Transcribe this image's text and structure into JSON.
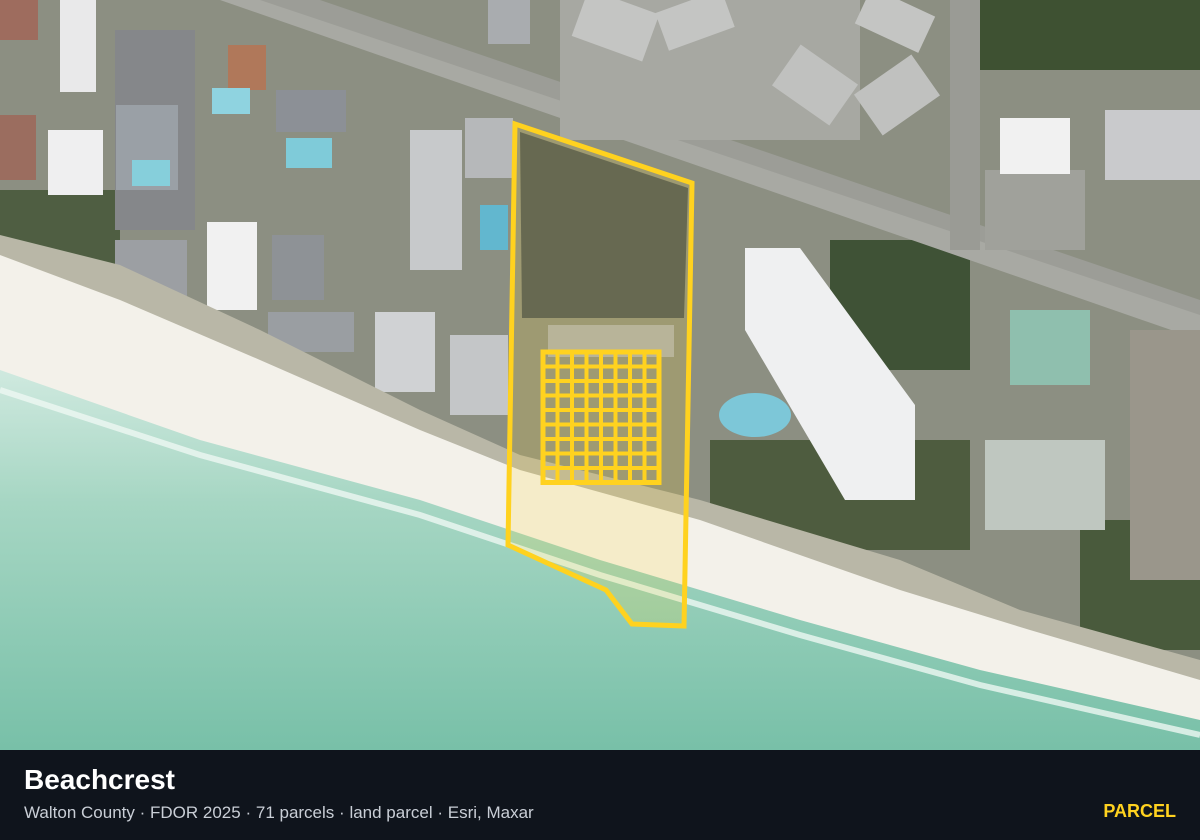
{
  "map": {
    "imagery": "aerial satellite",
    "highlight_color": "#FFD21F",
    "selected_unit_cells": 71
  },
  "footer": {
    "title": "Beachcrest",
    "meta_items": [
      "Walton County",
      "FDOR 2025",
      "71 parcels",
      "land parcel",
      "Esri, Maxar"
    ],
    "separator": "·",
    "badge_label": "PARCEL",
    "badge_color": "#FFD21F"
  }
}
